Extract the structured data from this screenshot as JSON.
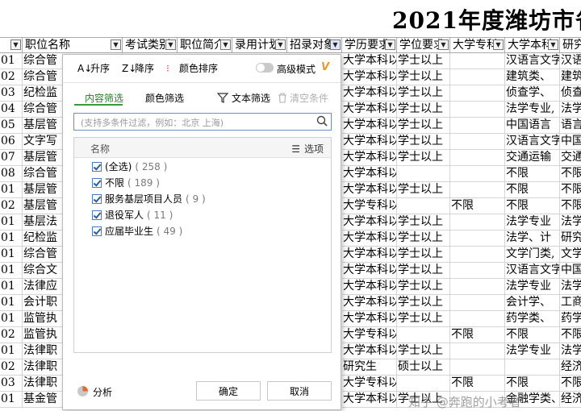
{
  "sheet_title": "2021年度潍坊市省",
  "columns": [
    {
      "label": "",
      "active": false
    },
    {
      "label": "职位名称",
      "active": false
    },
    {
      "label": "考试类别",
      "active": false
    },
    {
      "label": "职位简介",
      "active": false
    },
    {
      "label": "录用计划",
      "active": false
    },
    {
      "label": "招录对象",
      "active": true
    },
    {
      "label": "学历要求",
      "active": false
    },
    {
      "label": "学位要求",
      "active": false
    },
    {
      "label": "大学专科",
      "active": false
    },
    {
      "label": "大学本科",
      "active": false
    },
    {
      "label": "研究生",
      "active": false
    }
  ],
  "rows": [
    [
      "01",
      "综合管",
      "大学本科以",
      "学士以上",
      "",
      "汉语言文字",
      "汉语"
    ],
    [
      "02",
      "综合管",
      "大学本科以",
      "学士以上",
      "",
      "建筑类、",
      "建筑"
    ],
    [
      "03",
      "纪检监",
      "大学本科以",
      "学士以上",
      "",
      "侦查学、",
      "侦查"
    ],
    [
      "04",
      "综合管",
      "大学本科以",
      "学士以上",
      "",
      "法学专业,",
      "法学"
    ],
    [
      "05",
      "基层管",
      "大学本科以",
      "学士以上",
      "",
      "中国语言",
      "语言"
    ],
    [
      "06",
      "文字写",
      "大学本科以",
      "学士以上",
      "",
      "汉语言文字",
      "中国"
    ],
    [
      "07",
      "基层管",
      "大学本科以",
      "学士以上",
      "",
      "交通运输",
      "交通"
    ],
    [
      "08",
      "综合管",
      "大学本科以",
      "",
      "",
      "不限",
      "不限"
    ],
    [
      "01",
      "基层管",
      "大学本科以",
      "学士以上",
      "",
      "不限",
      "不限"
    ],
    [
      "02",
      "基层管",
      "大学专科以",
      "",
      "不限",
      "不限",
      "不限"
    ],
    [
      "01",
      "基层法",
      "大学本科以",
      "学士以上",
      "",
      "法学专业",
      "法学"
    ],
    [
      "01",
      "纪检监",
      "大学本科以",
      "学士以上",
      "",
      "法学、计",
      "研究"
    ],
    [
      "01",
      "综合管",
      "大学本科以",
      "学士以上",
      "",
      "文学门类,",
      "文学"
    ],
    [
      "01",
      "综合文",
      "大学本科以",
      "学士以上",
      "",
      "汉语言文字",
      "中国"
    ],
    [
      "01",
      "法律应",
      "大学本科以",
      "学士以上",
      "",
      "法学专业",
      "法学"
    ],
    [
      "01",
      "会计职",
      "大学本科以",
      "学士以上",
      "",
      "会计学、",
      "工商"
    ],
    [
      "01",
      "监管执",
      "大学本科以",
      "学士以上",
      "",
      "药学类、",
      "药学"
    ],
    [
      "02",
      "监管执",
      "大学专科以",
      "",
      "不限",
      "不限",
      "不限"
    ],
    [
      "01",
      "法律职",
      "大学本科以",
      "学士以上",
      "",
      "法学专业",
      "法学"
    ],
    [
      "02",
      "法律职",
      "研究生",
      "硕士以上",
      "",
      "",
      "经济"
    ],
    [
      "03",
      "法律职",
      "大学专科以",
      "",
      "不限",
      "不限",
      "不限"
    ],
    [
      "01",
      "基金管",
      "大学本科以",
      "学士以上",
      "",
      "金融学类、",
      "经济"
    ]
  ],
  "filter_panel": {
    "sort_asc": "升序",
    "sort_desc": "降序",
    "sort_color": "颜色排序",
    "advanced_mode": "高级模式",
    "vip_badge": "V",
    "tab_content": "内容筛选",
    "tab_color": "颜色筛选",
    "text_filter": "文本筛选",
    "clear": "清空条件",
    "search_placeholder": "(支持多条件过滤，例如：北京 上海)",
    "list_header_name": "名称",
    "list_header_options": "选项",
    "items": [
      {
        "label": "(全选)",
        "count": "( 258 )",
        "checked": true
      },
      {
        "label": "不限",
        "count": "( 189 )",
        "checked": true
      },
      {
        "label": "服务基层项目人员",
        "count": "( 9 )",
        "checked": true
      },
      {
        "label": "退役军人",
        "count": "( 11 )",
        "checked": true
      },
      {
        "label": "应届毕业生",
        "count": "( 49 )",
        "checked": true
      }
    ],
    "analysis": "分析",
    "ok": "确定",
    "cancel": "取消"
  },
  "watermark": "知乎 @奔跑的小考者",
  "colors": {
    "accent_green": "#3a9a3a",
    "vip_orange": "#e49b2c",
    "checkbox_blue": "#2a5d9f"
  }
}
